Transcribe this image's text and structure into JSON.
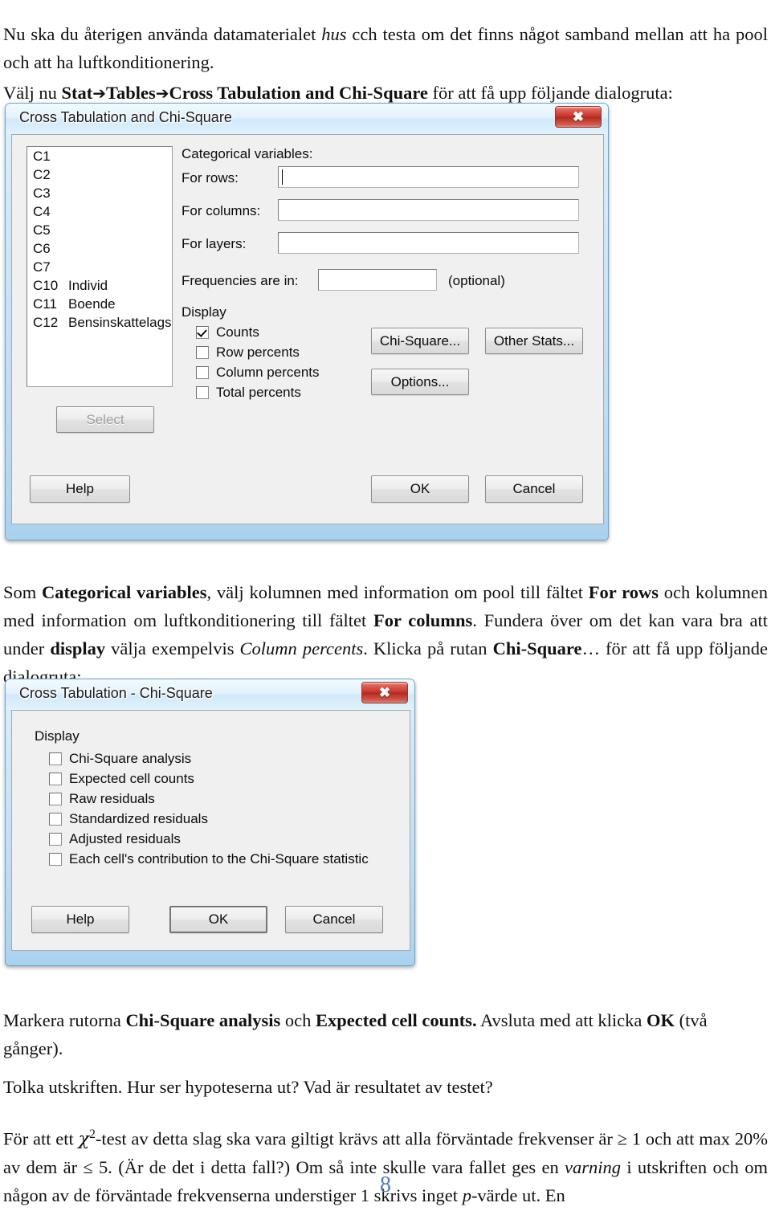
{
  "document": {
    "intro_paragraph": {
      "part1": "Nu ska du återigen använda datamaterialet ",
      "italic1": "hus",
      "part2": " cch testa om det finns något samband mellan att ha pool och att ha luftkonditionering."
    },
    "menu_paragraph": {
      "part1": "Välj nu ",
      "bold_stat": "Stat",
      "arrow1": "➔",
      "bold_tables": "Tables",
      "arrow2": "➔",
      "bold_cross": "Cross Tabulation and Chi-Square",
      "part2": " för att få upp följande dialogruta:"
    },
    "categorical_paragraph": {
      "p1": "Som ",
      "b1": "Categorical variables",
      "p2": ", välj kolumnen med information om pool till fältet ",
      "b2": "For rows",
      "p3": " och kolumnen med information om luftkonditionering till fältet ",
      "b3": "For columns",
      "p4": ". Fundera över om det kan vara bra att under ",
      "b4": "display",
      "p5": " välja exempelvis ",
      "i1": "Column percents",
      "p6": ". Klicka på rutan ",
      "b5": "Chi-Square",
      "p7": "… för att få upp följande dialogruta:"
    },
    "markera_paragraph": {
      "p1": "Markera rutorna ",
      "b1": "Chi-Square analysis",
      "p2": " och ",
      "b2": "Expected cell counts.",
      "p3": " Avsluta med att klicka ",
      "b3": "OK",
      "p4": " (två gånger)."
    },
    "tolka_paragraph": "Tolka utskriften. Hur ser hypoteserna ut? Vad är resultatet av testet?",
    "chitest_paragraph": {
      "p1": "För att ett ",
      "chi": "χ",
      "sup": "2",
      "p2": "-test av detta slag ska vara giltigt krävs att alla förväntade frekvenser är ≥ 1 och att max 20% av dem är  ≤ 5. (Är de det i detta fall?) Om så inte skulle vara fallet ges en ",
      "i1": "varning",
      "p3": " i utskriften och om någon av de förväntade frekvenserna understiger 1 skrivs inget ",
      "i2": "p",
      "p4": "-värde ut. En"
    },
    "page_number": "8"
  },
  "dialog1": {
    "title": "Cross Tabulation and Chi-Square",
    "close_label": "✖",
    "variable_list": [
      {
        "col": "C1",
        "name": ""
      },
      {
        "col": "C2",
        "name": ""
      },
      {
        "col": "C3",
        "name": ""
      },
      {
        "col": "C4",
        "name": ""
      },
      {
        "col": "C5",
        "name": ""
      },
      {
        "col": "C6",
        "name": ""
      },
      {
        "col": "C7",
        "name": ""
      },
      {
        "col": "C10",
        "name": "Individ"
      },
      {
        "col": "C11",
        "name": "Boende"
      },
      {
        "col": "C12",
        "name": "Bensinskattelags"
      }
    ],
    "select_button": "Select",
    "help_button": "Help",
    "categorical_label": "Categorical variables:",
    "for_rows_label": "For rows:",
    "for_rows_value": "",
    "for_columns_label": "For columns:",
    "for_columns_value": "",
    "for_layers_label": "For layers:",
    "for_layers_value": "",
    "frequencies_label": "Frequencies are in:",
    "frequencies_value": "",
    "optional_label": "(optional)",
    "display_label": "Display",
    "display_options": [
      {
        "label": "Counts",
        "checked": true
      },
      {
        "label": "Row percents",
        "checked": false
      },
      {
        "label": "Column percents",
        "checked": false
      },
      {
        "label": "Total percents",
        "checked": false
      }
    ],
    "chi_square_button": "Chi-Square...",
    "other_stats_button": "Other Stats...",
    "options_button": "Options...",
    "ok_button": "OK",
    "cancel_button": "Cancel"
  },
  "dialog2": {
    "title": "Cross Tabulation - Chi-Square",
    "close_label": "✖",
    "display_label": "Display",
    "display_options": [
      {
        "label": "Chi-Square analysis",
        "checked": false
      },
      {
        "label": "Expected cell counts",
        "checked": false
      },
      {
        "label": "Raw residuals",
        "checked": false
      },
      {
        "label": "Standardized residuals",
        "checked": false
      },
      {
        "label": "Adjusted residuals",
        "checked": false
      },
      {
        "label": "Each cell's contribution to the Chi-Square statistic",
        "checked": false
      }
    ],
    "help_button": "Help",
    "ok_button": "OK",
    "cancel_button": "Cancel"
  },
  "colors": {
    "close_red": "#c5352a",
    "title_blue": "#d2e9fa",
    "page_number_blue": "#4a7ebb",
    "dialog_face": "#f0f0f0"
  }
}
